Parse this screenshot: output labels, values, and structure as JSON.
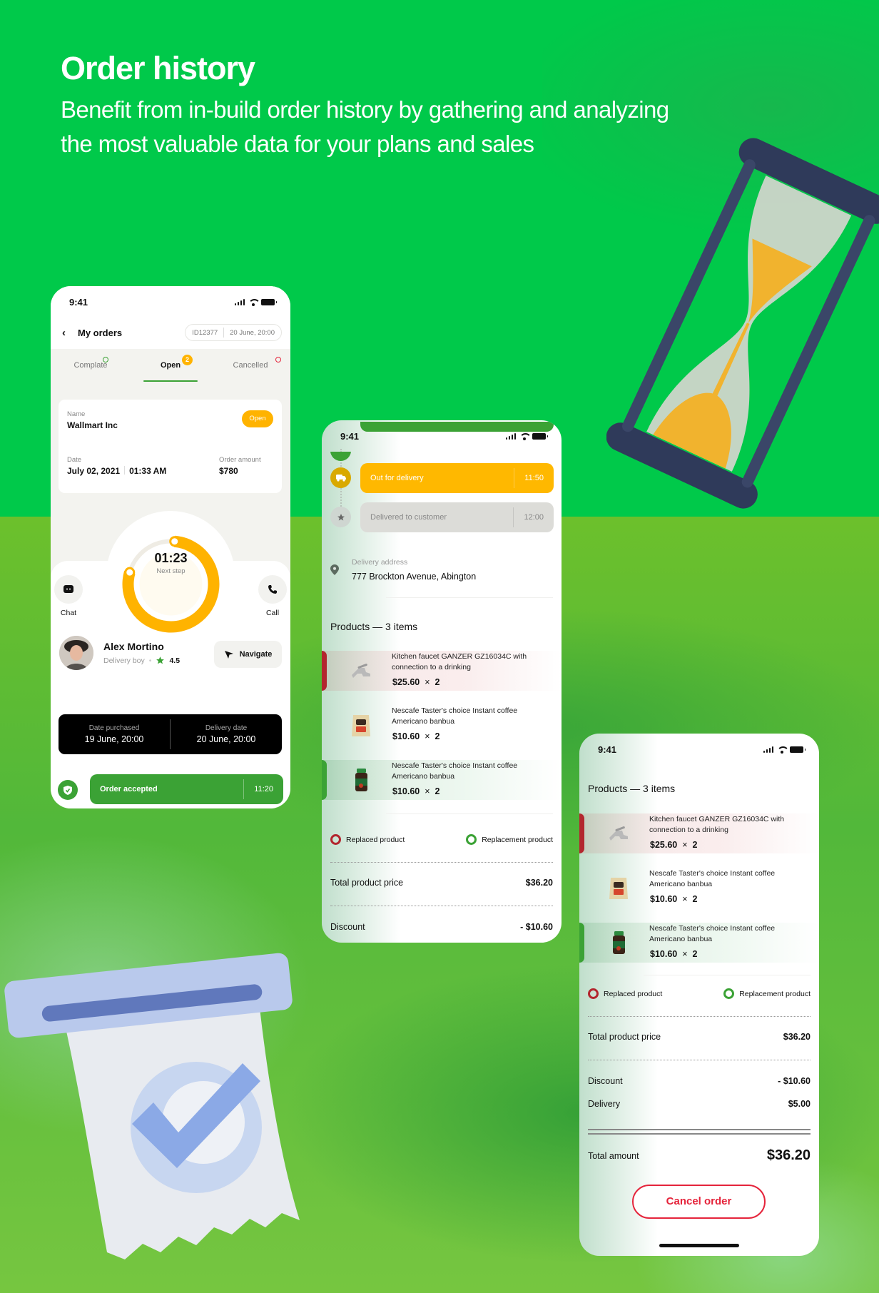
{
  "hero": {
    "title": "Order history",
    "subtitle": "Benefit from in-build order history by gathering and analyzing the most valuable data for your plans and sales"
  },
  "colors": {
    "brand_green": "#3BA235",
    "accent_yellow": "#FFB300",
    "danger_red": "#E5243B",
    "replaced_red": "#B3262E",
    "bg_green": "#00C94A"
  },
  "illustrations": {
    "top_right": "hourglass-illustration",
    "bottom_left": "receipt-check-illustration"
  },
  "phone1": {
    "status_time": "9:41",
    "header": {
      "back_icon": "chevron-left-icon",
      "title": "My orders",
      "order_id": "ID12377",
      "order_date": "20 June, 20:00"
    },
    "tabs": [
      {
        "label": "Complate",
        "indicator": "green-ring"
      },
      {
        "label": "Open",
        "badge": "2",
        "active": true
      },
      {
        "label": "Cancelled",
        "indicator": "red-ring"
      }
    ],
    "order_card": {
      "name_label": "Name",
      "name_value": "Wallmart Inc",
      "status": "Open",
      "date_label": "Date",
      "date_value": "July 02, 2021",
      "time_value": "01:33 AM",
      "amount_label": "Order amount",
      "amount_value": "$780"
    },
    "timer": {
      "time": "01:23",
      "label": "Next step",
      "progress": 0.78
    },
    "chat_label": "Chat",
    "call_label": "Call",
    "courier": {
      "name": "Alex Mortino",
      "role": "Delivery boy",
      "rating": "4.5",
      "navigate_label": "Navigate"
    },
    "dates": {
      "purchased_label": "Date purchased",
      "purchased_value": "19 June, 20:00",
      "delivery_label": "Delivery date",
      "delivery_value": "20 June, 20:00"
    },
    "step": {
      "label": "Order accepted",
      "time": "11:20"
    }
  },
  "phone2": {
    "status_time": "9:41",
    "timeline": [
      {
        "label": "Order accepted",
        "time": "11:20",
        "state": "done"
      },
      {
        "label": "Out for delivery",
        "time": "11:50",
        "state": "current"
      },
      {
        "label": "Delivered to customer",
        "time": "12:00",
        "state": "pending"
      }
    ],
    "address_label": "Delivery address",
    "address_value": "777 Brockton Avenue, Abington",
    "products_title": "Products — 3 items",
    "products": [
      {
        "name": "Kitchen faucet GANZER GZ16034C with connection to a drinking",
        "price": "$25.60",
        "qty": "2",
        "type": "replaced"
      },
      {
        "name": "Nescafe Taster's choice Instant coffee Americano banbua",
        "price": "$10.60",
        "qty": "2",
        "type": "normal"
      },
      {
        "name": "Nescafe Taster's choice Instant coffee Americano banbua",
        "price": "$10.60",
        "qty": "2",
        "type": "replacement"
      }
    ],
    "legend": {
      "replaced": "Replaced product",
      "replacement": "Replacement product"
    },
    "total_product_label": "Total product price",
    "total_product_value": "$36.20",
    "discount_label": "Discount",
    "discount_value": "- $10.60"
  },
  "phone3": {
    "status_time": "9:41",
    "products_title": "Products — 3 items",
    "products": [
      {
        "name": "Kitchen faucet GANZER GZ16034C with connection to a drinking",
        "price": "$25.60",
        "qty": "2",
        "type": "replaced"
      },
      {
        "name": "Nescafe Taster's choice Instant coffee Americano banbua",
        "price": "$10.60",
        "qty": "2",
        "type": "normal"
      },
      {
        "name": "Nescafe Taster's choice Instant coffee Americano banbua",
        "price": "$10.60",
        "qty": "2",
        "type": "replacement"
      }
    ],
    "legend": {
      "replaced": "Replaced product",
      "replacement": "Replacement product"
    },
    "total_product_label": "Total product price",
    "total_product_value": "$36.20",
    "discount_label": "Discount",
    "discount_value": "- $10.60",
    "delivery_label": "Delivery",
    "delivery_value": "$5.00",
    "total_amount_label": "Total amount",
    "total_amount_value": "$36.20",
    "cancel_label": "Cancel order"
  },
  "qty_separator": "×"
}
